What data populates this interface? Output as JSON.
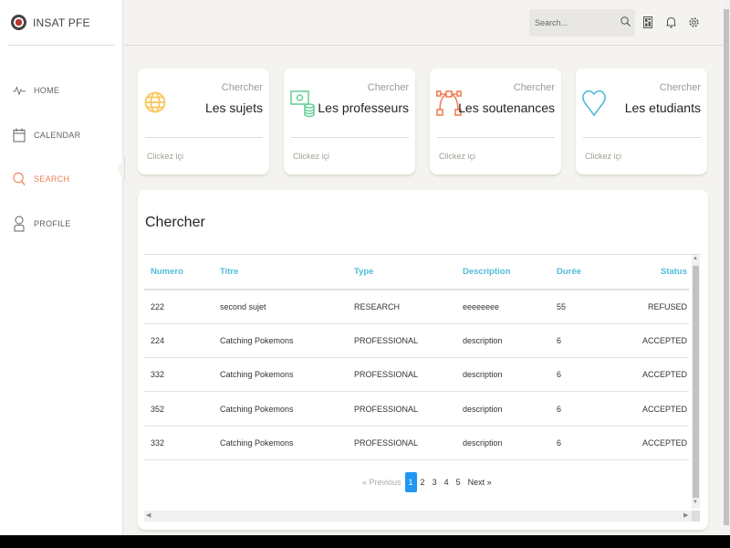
{
  "brand": {
    "name": "INSAT PFE"
  },
  "nav": [
    {
      "label": "HOME",
      "icon": "pulse-icon"
    },
    {
      "label": "CALENDAR",
      "icon": "calendar-icon"
    },
    {
      "label": "SEARCH",
      "icon": "search-icon",
      "active": true
    },
    {
      "label": "PROFILE",
      "icon": "user-icon"
    }
  ],
  "topbar": {
    "search_placeholder": "Search..."
  },
  "cards": [
    {
      "label": "Chercher",
      "title": "Les sujets",
      "footer": "Clickez içi",
      "icon": "globe-icon",
      "color": "#fbc658"
    },
    {
      "label": "Chercher",
      "title": "Les professeurs",
      "footer": "Clickez içi",
      "icon": "money-icon",
      "color": "#6bd098"
    },
    {
      "label": "Chercher",
      "title": "Les soutenances",
      "footer": "Clickez içi",
      "icon": "vector-icon",
      "color": "#ef8157"
    },
    {
      "label": "Chercher",
      "title": "Les etudiants",
      "footer": "Clickez içi",
      "icon": "heart-icon",
      "color": "#51bcda"
    }
  ],
  "panel": {
    "title": "Chercher",
    "columns": [
      "Numero",
      "Titre",
      "Type",
      "Description",
      "Durée",
      "Status"
    ],
    "rows": [
      [
        "222",
        "second sujet",
        "RESEARCH",
        "eeeeeeee",
        "55",
        "REFUSED"
      ],
      [
        "224",
        "Catching Pokemons",
        "PROFESSIONAL",
        "description",
        "6",
        "ACCEPTED"
      ],
      [
        "332",
        "Catching Pokemons",
        "PROFESSIONAL",
        "description",
        "6",
        "ACCEPTED"
      ],
      [
        "352",
        "Catching Pokemons",
        "PROFESSIONAL",
        "description",
        "6",
        "ACCEPTED"
      ],
      [
        "332",
        "Catching Pokemons",
        "PROFESSIONAL",
        "description",
        "6",
        "ACCEPTED"
      ]
    ],
    "pagination": {
      "previous": "« Previous",
      "pages": [
        "1",
        "2",
        "3",
        "4",
        "5"
      ],
      "current": "1",
      "next": "Next »"
    }
  }
}
